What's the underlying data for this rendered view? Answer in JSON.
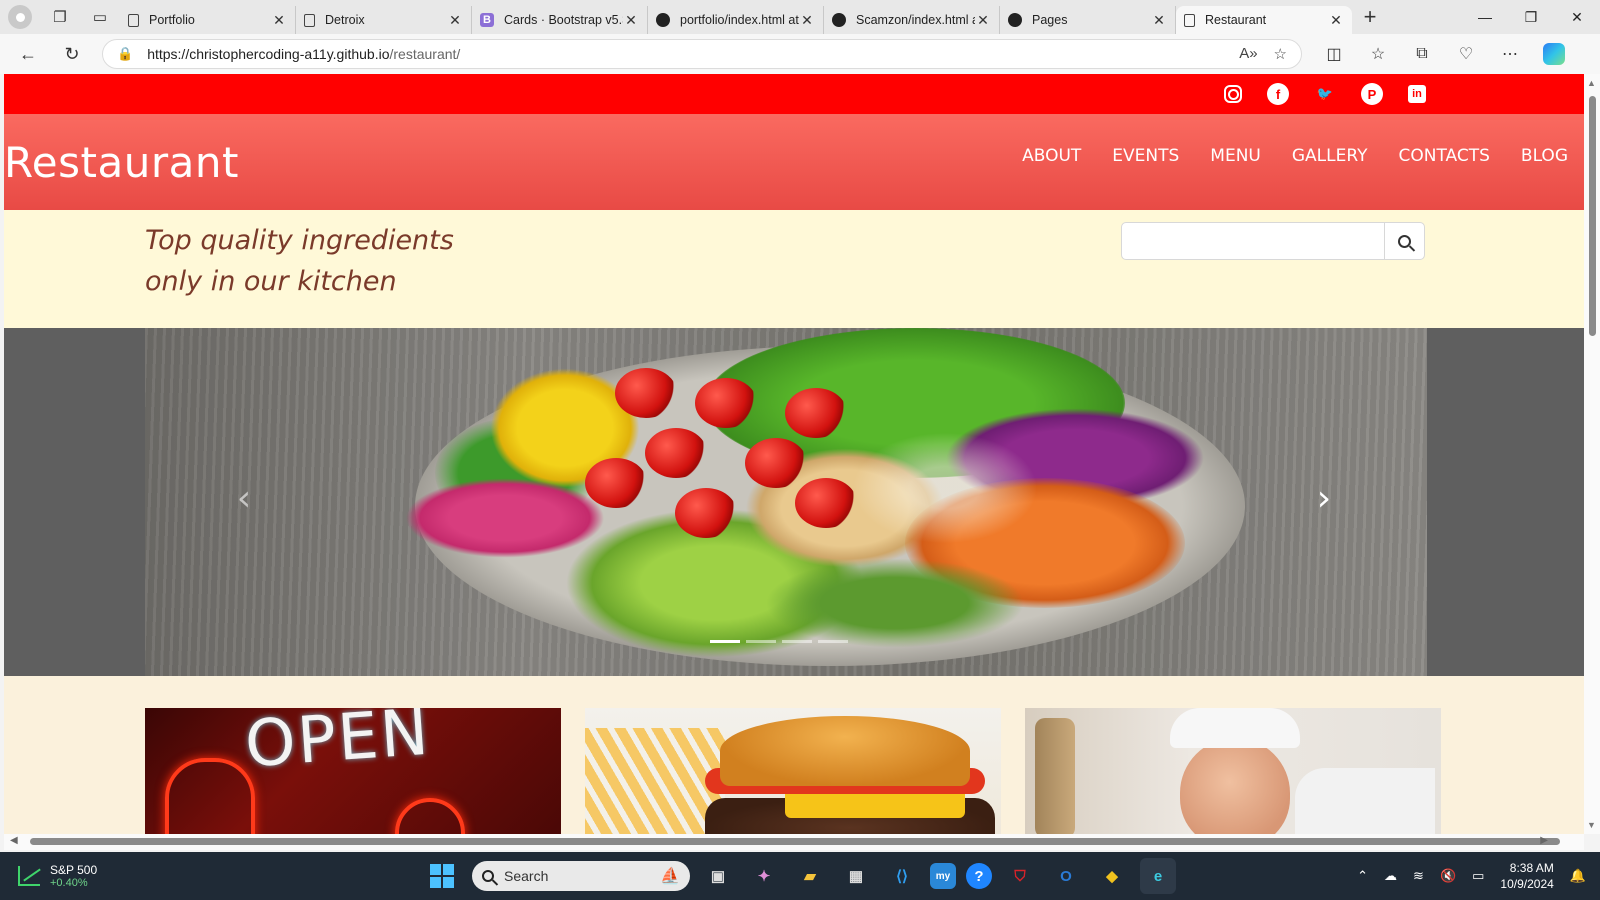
{
  "browser": {
    "tabs": [
      {
        "title": "Portfolio",
        "favicon": "doc"
      },
      {
        "title": "Detroix",
        "favicon": "doc"
      },
      {
        "title": "Cards · Bootstrap v5.3",
        "favicon": "bootstrap"
      },
      {
        "title": "portfolio/index.html at",
        "favicon": "github"
      },
      {
        "title": "Scamzon/index.html a",
        "favicon": "github"
      },
      {
        "title": "Pages",
        "favicon": "github"
      },
      {
        "title": "Restaurant",
        "favicon": "doc",
        "active": true
      }
    ],
    "url_host": "https://christophercoding-a11y.github.io",
    "url_path": "/restaurant/"
  },
  "site": {
    "social_icons": [
      "instagram-icon",
      "facebook-icon",
      "twitter-icon",
      "pinterest-icon",
      "linkedin-icon"
    ],
    "brand": "Restaurant",
    "nav": [
      "ABOUT",
      "EVENTS",
      "MENU",
      "GALLERY",
      "CONTACTS",
      "BLOG"
    ],
    "tagline_line1": "Top quality ingredients",
    "tagline_line2": "only in our kitchen",
    "search_placeholder": "",
    "carousel": {
      "slides": 4,
      "active": 0
    },
    "cards": [
      "open-sign-image",
      "burger-image",
      "chef-image"
    ],
    "colors": {
      "topbar": "#ff0000",
      "navbar": "#f05a52",
      "strip": "#fff9d8",
      "cards_bg": "#fbf1dc"
    }
  },
  "taskbar": {
    "stock_name": "S&P 500",
    "stock_change": "+0.40%",
    "search_label": "Search",
    "time": "8:38 AM",
    "date": "10/9/2024"
  }
}
